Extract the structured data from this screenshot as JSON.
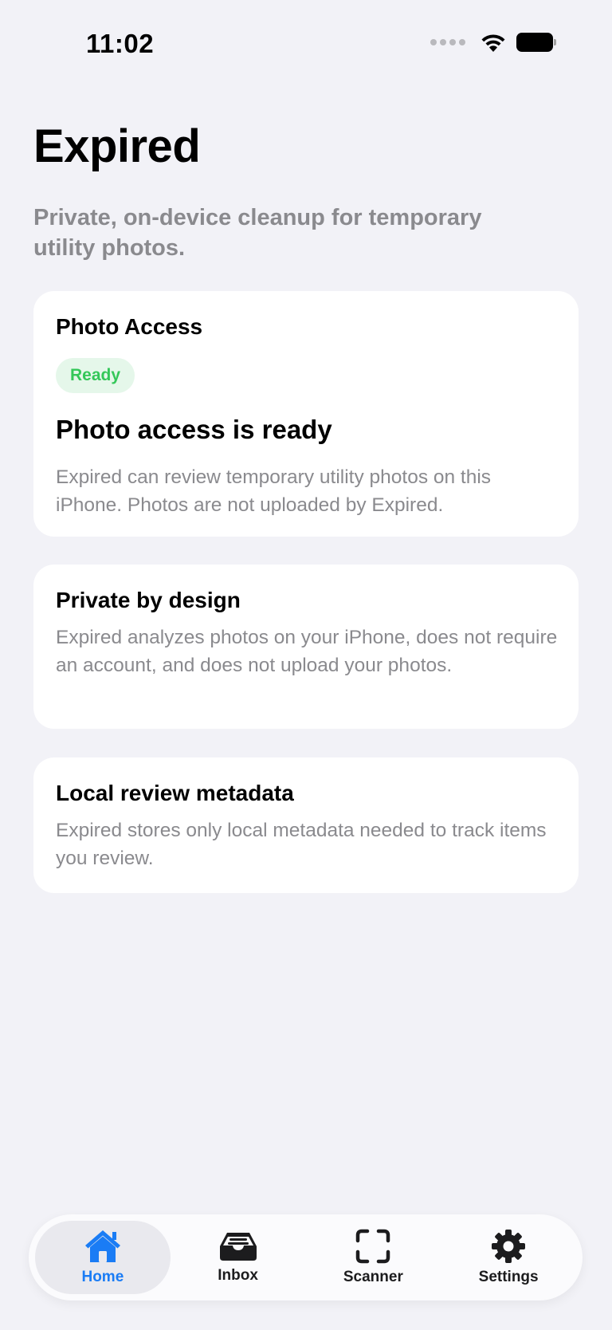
{
  "status_bar": {
    "time": "11:02"
  },
  "header": {
    "title": "Expired",
    "subtitle": "Private, on-device cleanup for temporary utility photos."
  },
  "cards": {
    "photo_access": {
      "heading": "Photo Access",
      "badge": "Ready",
      "subheading": "Photo access is ready",
      "body": "Expired can review temporary utility photos on this iPhone. Photos are not uploaded by Expired."
    },
    "private": {
      "heading": "Private by design",
      "body": "Expired analyzes photos on your iPhone, does not require an account, and does not upload your photos."
    },
    "local": {
      "heading": "Local review metadata",
      "body": "Expired stores only local metadata needed to track items you review."
    }
  },
  "tab_bar": {
    "active": "Home",
    "tabs": [
      {
        "label": "Home",
        "icon": "house-icon"
      },
      {
        "label": "Inbox",
        "icon": "tray-icon"
      },
      {
        "label": "Scanner",
        "icon": "viewfinder-icon"
      },
      {
        "label": "Settings",
        "icon": "gear-icon"
      }
    ]
  },
  "colors": {
    "background": "#f2f2f7",
    "accent": "#1a7cf5",
    "ready_green": "#34c759",
    "secondary_text": "#8a8a8e"
  }
}
